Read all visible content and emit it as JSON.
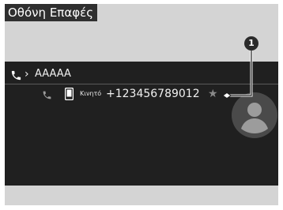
{
  "header": {
    "title": "Οθόνη Επαφές"
  },
  "contact": {
    "name": "AAAAA",
    "phone_type": "Κινητό",
    "phone_number": "+123456789012",
    "favorite_star": "★"
  },
  "callout": {
    "number": "1"
  },
  "icons": [
    "phone-icon",
    "chevron-right-icon",
    "call-icon",
    "mobile-phone-icon",
    "star-icon",
    "contact-avatar-icon"
  ],
  "colors": {
    "screen_bg": "#202020",
    "frame_bg": "#d4d4d4",
    "title_bg": "#2f2f2f"
  }
}
